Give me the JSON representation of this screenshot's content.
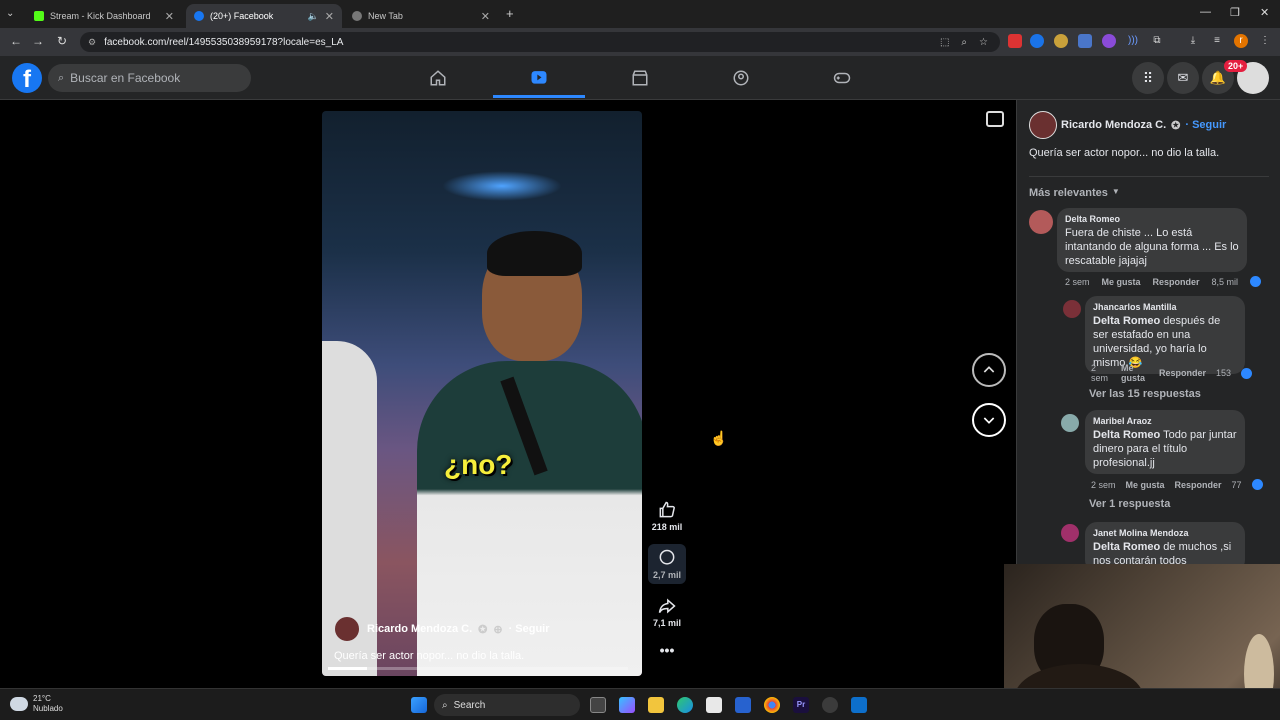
{
  "tabs": [
    {
      "title": "Stream - Kick Dashboard",
      "color": "#53fc18"
    },
    {
      "title": "(20+) Facebook",
      "color": "#1877f2"
    },
    {
      "title": "New Tab",
      "color": "#888888"
    }
  ],
  "address": "facebook.com/reel/1495535038959178?locale=es_LA",
  "search": {
    "placeholder": "Buscar en Facebook"
  },
  "notifications_badge": "20+",
  "reel": {
    "caption_word": "¿no?",
    "author": "Ricardo Mendoza C.",
    "follow": "· Seguir",
    "description": "Quería ser actor nopor... no dio la talla.",
    "likes": "218 mil",
    "comments": "2,7 mil",
    "shares": "7,1 mil",
    "progress": 0.13
  },
  "panel": {
    "author": "Ricardo Mendoza C.",
    "follow": "· Seguir",
    "description": "Quería ser actor nopor... no dio la talla.",
    "sort_label": "Más relevantes",
    "comments": [
      {
        "name": "Delta Romeo",
        "text": "Fuera de chiste ... Lo está intantando de alguna forma ... Es lo rescatable jajajaj",
        "time": "2 sem",
        "like": "Me gusta",
        "reply": "Responder",
        "count": "8,5 mil"
      },
      {
        "name": "Jhancarlos Mantilla",
        "mention": "Delta Romeo",
        "text": " después de ser estafado en una universidad, yo haría lo mismo 😂",
        "time": "2 sem",
        "like": "Me gusta",
        "reply": "Responder",
        "count": "153"
      },
      {
        "name": "Maribel Araoz",
        "mention": "Delta Romeo",
        "text": " Todo par juntar dinero para el título profesional.jj",
        "time": "2 sem",
        "like": "Me gusta",
        "reply": "Responder",
        "count": "77"
      },
      {
        "name": "Janet Molina Mendoza",
        "mention": "Delta Romeo",
        "text": " de muchos ,si nos contarán todos"
      }
    ],
    "view_replies_1": "Ver las 15 respuestas",
    "view_replies_2": "Ver 1 respuesta"
  },
  "taskbar": {
    "temp": "21°C",
    "weather": "Nublado",
    "search": "Search"
  }
}
